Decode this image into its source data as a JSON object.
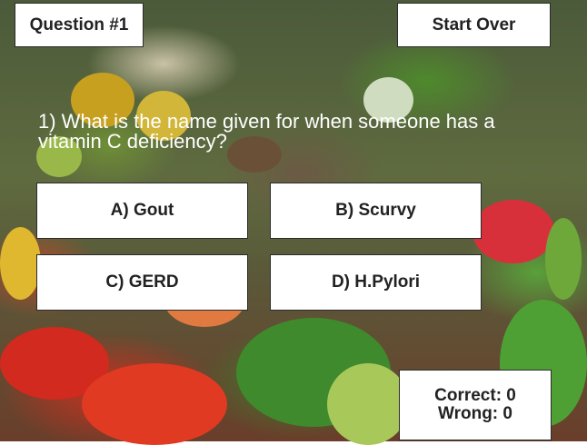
{
  "header": {
    "question_label": "Question #1",
    "start_over_label": "Start Over"
  },
  "question": {
    "text": "1) What is the name given for when someone has a vitamin C deficiency?"
  },
  "answers": [
    {
      "label": "A) Gout"
    },
    {
      "label": "B) Scurvy"
    },
    {
      "label": "C) GERD"
    },
    {
      "label": "D) H.Pylori"
    }
  ],
  "score": {
    "correct": "Correct: 0",
    "wrong": "Wrong: 0"
  },
  "colors": {
    "box_bg": "#ffffff",
    "box_text": "#222222",
    "question_text": "#ffffff"
  }
}
